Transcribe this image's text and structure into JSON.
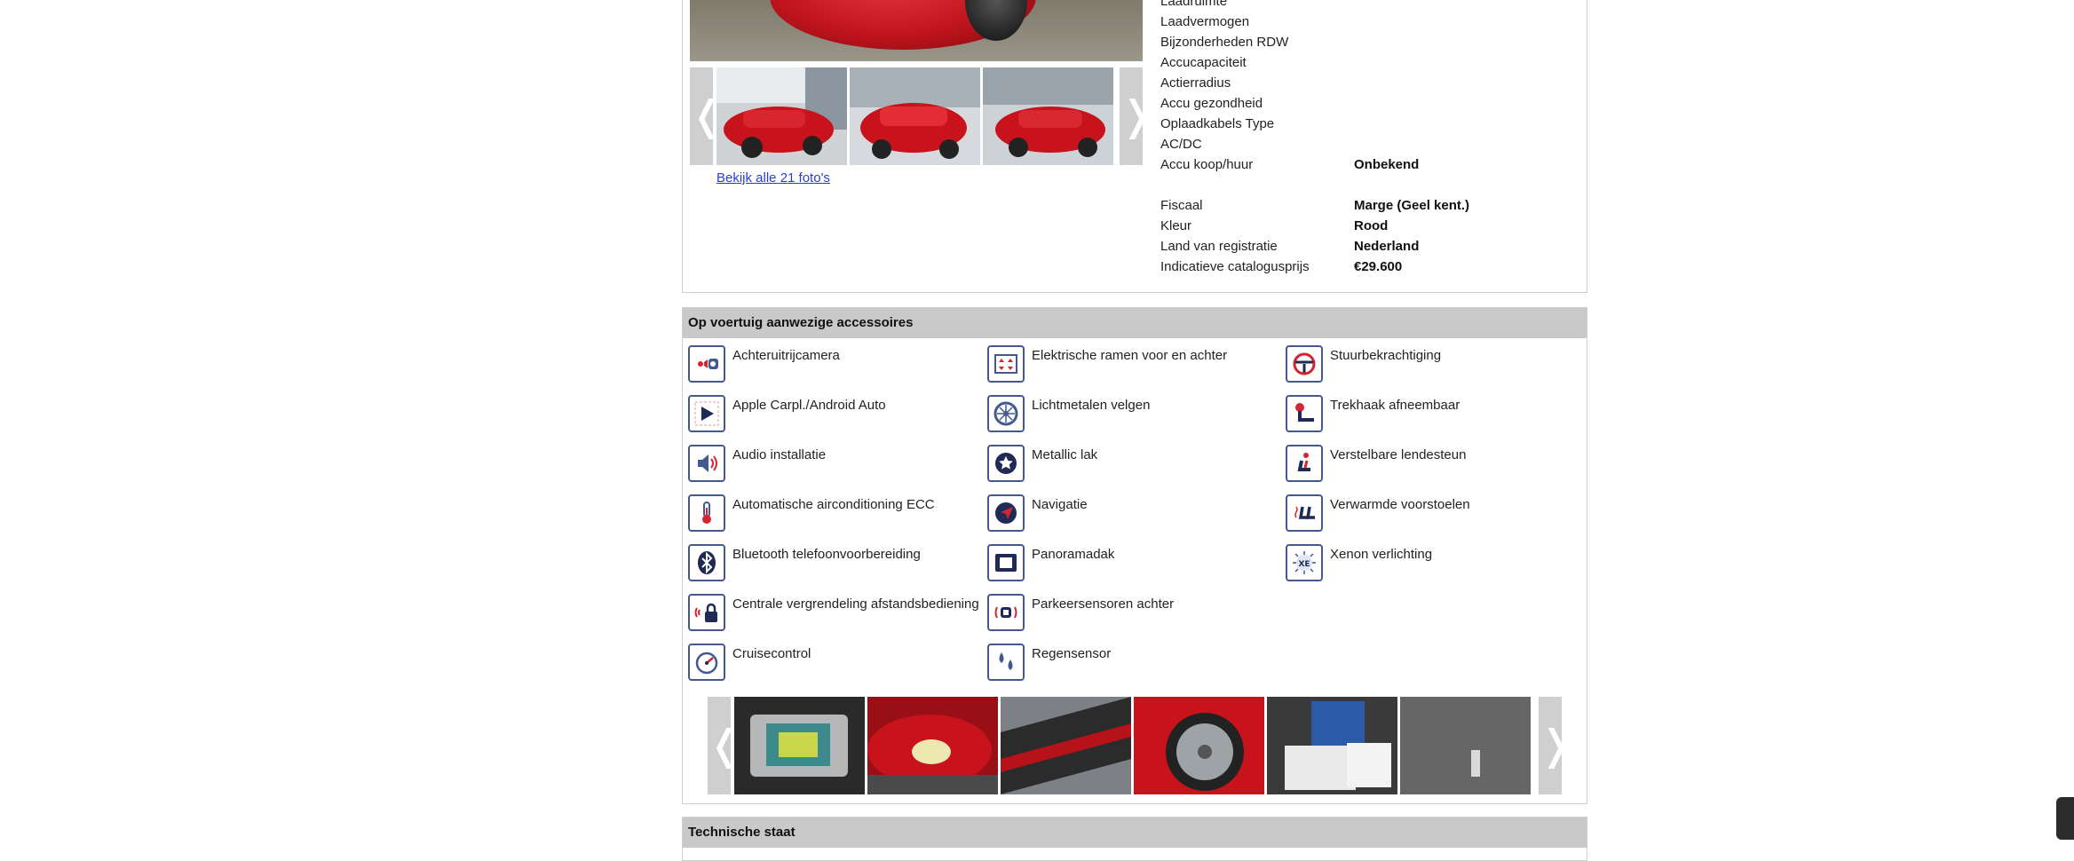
{
  "gallery": {
    "prev_glyph": "❬",
    "next_glyph": "❭",
    "all_photos_link": "Bekijk alle 21 foto's"
  },
  "specs": [
    {
      "label": "Laadruimte",
      "value": ""
    },
    {
      "label": "Laadvermogen",
      "value": ""
    },
    {
      "label": "Bijzonderheden RDW",
      "value": ""
    },
    {
      "label": "Accucapaciteit",
      "value": ""
    },
    {
      "label": "Actierradius",
      "value": ""
    },
    {
      "label": "Accu gezondheid",
      "value": ""
    },
    {
      "label": "Oplaadkabels Type",
      "value": ""
    },
    {
      "label": "AC/DC",
      "value": ""
    },
    {
      "label": "Accu koop/huur",
      "value": "Onbekend"
    },
    {
      "label": "Fiscaal",
      "value": "Marge (Geel kent.)"
    },
    {
      "label": "Kleur",
      "value": "Rood"
    },
    {
      "label": "Land van registratie",
      "value": "Nederland"
    },
    {
      "label": "Indicatieve catalogusprijs",
      "value": "€29.600"
    }
  ],
  "accessories": {
    "title": "Op voertuig aanwezige accessoires",
    "items": [
      {
        "label": "Achteruitrijcamera",
        "icon": "rear-camera-icon"
      },
      {
        "label": "Apple Carpl./Android Auto",
        "icon": "carplay-icon"
      },
      {
        "label": "Audio installatie",
        "icon": "speaker-icon"
      },
      {
        "label": "Automatische airconditioning ECC",
        "icon": "thermometer-icon"
      },
      {
        "label": "Bluetooth telefoonvoorbereiding",
        "icon": "bluetooth-icon"
      },
      {
        "label": "Centrale vergrendeling afstandsbediening",
        "icon": "lock-icon"
      },
      {
        "label": "Cruisecontrol",
        "icon": "speedometer-icon"
      },
      {
        "label": "Elektrische ramen voor en achter",
        "icon": "power-windows-icon"
      },
      {
        "label": "Lichtmetalen velgen",
        "icon": "alloy-wheel-icon"
      },
      {
        "label": "Metallic lak",
        "icon": "metallic-paint-icon"
      },
      {
        "label": "Navigatie",
        "icon": "navigation-icon"
      },
      {
        "label": "Panoramadak",
        "icon": "sunroof-icon"
      },
      {
        "label": "Parkeersensoren achter",
        "icon": "parking-sensor-icon"
      },
      {
        "label": "Regensensor",
        "icon": "rain-sensor-icon"
      },
      {
        "label": "Stuurbekrachtiging",
        "icon": "steering-wheel-icon"
      },
      {
        "label": "Trekhaak afneembaar",
        "icon": "tow-hitch-icon"
      },
      {
        "label": "Verstelbare lendesteun",
        "icon": "lumbar-support-icon"
      },
      {
        "label": "Verwarmde voorstoelen",
        "icon": "heated-seats-icon"
      },
      {
        "label": "Xenon verlichting",
        "icon": "xenon-lights-icon"
      }
    ]
  },
  "technical": {
    "title": "Technische staat"
  },
  "colors": {
    "icon_border": "#44598f",
    "icon_accent": "#d62430",
    "header_bg": "#c9c9c9",
    "link": "#2a3fcf"
  }
}
